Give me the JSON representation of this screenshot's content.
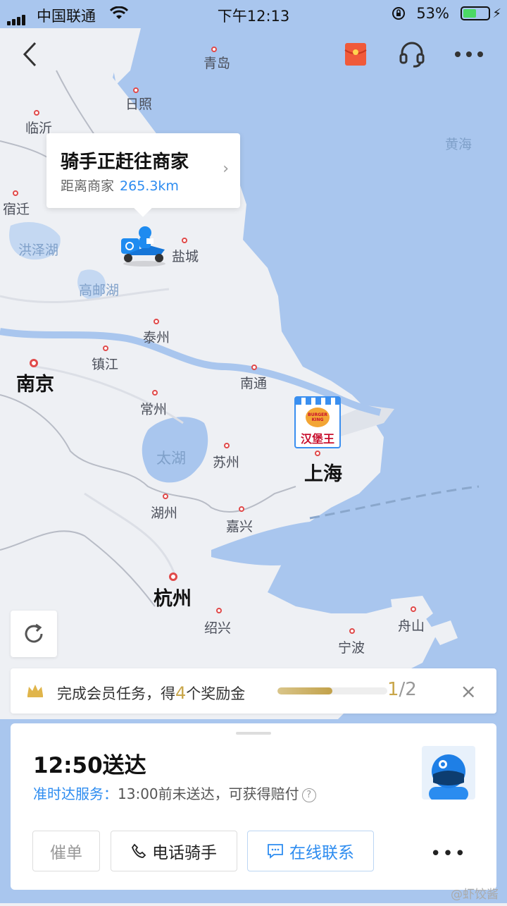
{
  "status_bar": {
    "carrier": "中国联通",
    "time": "下午12:13",
    "battery_pct": "53%",
    "battery_level": 0.53
  },
  "top_bar": {
    "back_icon": "chevron-left-icon",
    "red_packet_icon": "red-envelope-icon",
    "support_icon": "headset-icon",
    "more_icon": "more-dots-icon"
  },
  "map": {
    "labels": {
      "qingdao": "青岛",
      "rizhao": "日照",
      "linyi": "临沂",
      "huanghai": "黄海",
      "suqian": "宿迁",
      "hongzehu": "洪泽湖",
      "yancheng": "盐城",
      "gaoyouhu": "高邮湖",
      "taizhou": "泰州",
      "zhenjiang": "镇江",
      "nanjing": "南京",
      "nantong": "南通",
      "changzhou": "常州",
      "taihu": "太湖",
      "suzhou": "苏州",
      "shanghai": "上海",
      "huzhou": "湖州",
      "jiaxing": "嘉兴",
      "hangzhou": "杭州",
      "shaoxing": "绍兴",
      "zhoushan": "舟山",
      "ningbo": "宁波"
    },
    "merchant_logo_text": "汉堡王",
    "merchant_brand_text": "BURGER KING"
  },
  "callout": {
    "title": "骑手正赶往商家",
    "distance_label": "距离商家",
    "distance_value": "265.3km"
  },
  "task_banner": {
    "text_prefix": "完成会员任务，得",
    "reward_count": "4",
    "text_suffix": "个奖励金",
    "progress": 0.5,
    "progress_done": "1",
    "progress_total": "/2",
    "close": "×"
  },
  "order_card": {
    "eta": "12:50送达",
    "service_name": "准时达服务：",
    "service_desc": "13:00前未送达，可获得赔付",
    "help_mark": "?",
    "buttons": {
      "urge": "催单",
      "call": "电话骑手",
      "chat": "在线联系",
      "more": "•••"
    }
  },
  "watermark": "@虾饺酱"
}
